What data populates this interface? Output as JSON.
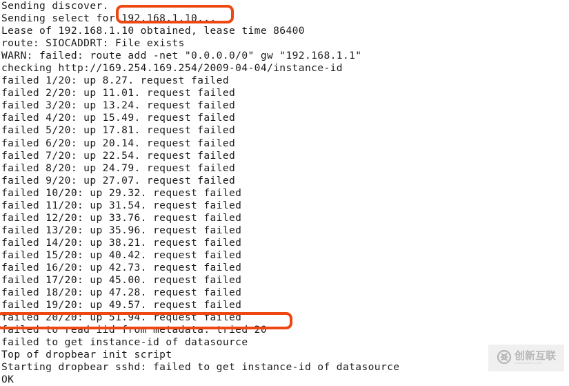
{
  "terminal": {
    "background_color": "#ffffff",
    "text_color": "#1b1b1b",
    "lines": [
      "Sending discover.",
      "Sending select for 192.168.1.10...",
      "Lease of 192.168.1.10 obtained, lease time 86400",
      "route: SIOCADDRT: File exists",
      "WARN: failed: route add -net \"0.0.0.0/0\" gw \"192.168.1.1\"",
      "checking http://169.254.169.254/2009-04-04/instance-id",
      "failed 1/20: up 8.27. request failed",
      "failed 2/20: up 11.01. request failed",
      "failed 3/20: up 13.24. request failed",
      "failed 4/20: up 15.49. request failed",
      "failed 5/20: up 17.81. request failed",
      "failed 6/20: up 20.14. request failed",
      "failed 7/20: up 22.54. request failed",
      "failed 8/20: up 24.79. request failed",
      "failed 9/20: up 27.07. request failed",
      "failed 10/20: up 29.32. request failed",
      "failed 11/20: up 31.54. request failed",
      "failed 12/20: up 33.76. request failed",
      "failed 13/20: up 35.96. request failed",
      "failed 14/20: up 38.21. request failed",
      "failed 15/20: up 40.42. request failed",
      "failed 16/20: up 42.73. request failed",
      "failed 17/20: up 45.00. request failed",
      "failed 18/20: up 47.28. request failed",
      "failed 19/20: up 49.57. request failed",
      "failed 20/20: up 51.94. request failed",
      "failed to read iid from metadata. tried 20",
      "failed to get instance-id of datasource",
      "Top of dropbear init script",
      "Starting dropbear sshd: failed to get instance-id of datasource",
      "OK"
    ]
  },
  "annotations": {
    "color": "#ee4712",
    "boxes": [
      {
        "id": "highlight-ip",
        "label": "192.168.1.10...",
        "target_line_index": 1
      },
      {
        "id": "highlight-iid",
        "label": "failed to read iid from metadata. tried 20",
        "target_line_index": 26
      }
    ]
  },
  "watermark": {
    "mark_icon": "circled-x-logo-icon",
    "brand_cn": "创新互联",
    "brand_en": "CDXWXCMS.COM",
    "color": "#b4b4b4",
    "background": "#f0f0f0"
  }
}
